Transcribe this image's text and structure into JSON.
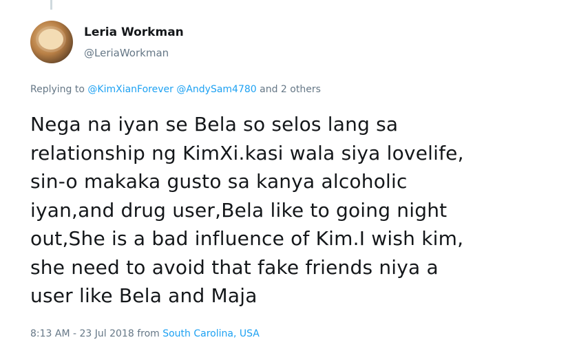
{
  "colors": {
    "text": "#14171a",
    "secondary": "#657786",
    "link": "#1da1f2",
    "thread": "#cfd9de"
  },
  "tweet": {
    "author_name": "Leria Workman",
    "author_handle": "@LeriaWorkman",
    "avatar_icon": "avatar",
    "reply": {
      "prefix": "Replying to",
      "mention_1": "@KimXianForever",
      "mention_2": "@AndySam4780",
      "suffix": "and 2 others"
    },
    "text": "Nega na iyan se Bela so selos lang sa\nrelationship ng KimXi.kasi wala siya lovelife,\nsin-o makaka gusto sa kanya alcoholic\niyan,and drug user,Bela like to going night\nout,She is a bad influence of Kim.I wish  kim,\nshe need to avoid that fake friends niya a\nuser like Bela and Maja",
    "timestamp": "8:13 AM - 23 Jul 2018",
    "from_label": "from",
    "location": "South Carolina, USA"
  }
}
